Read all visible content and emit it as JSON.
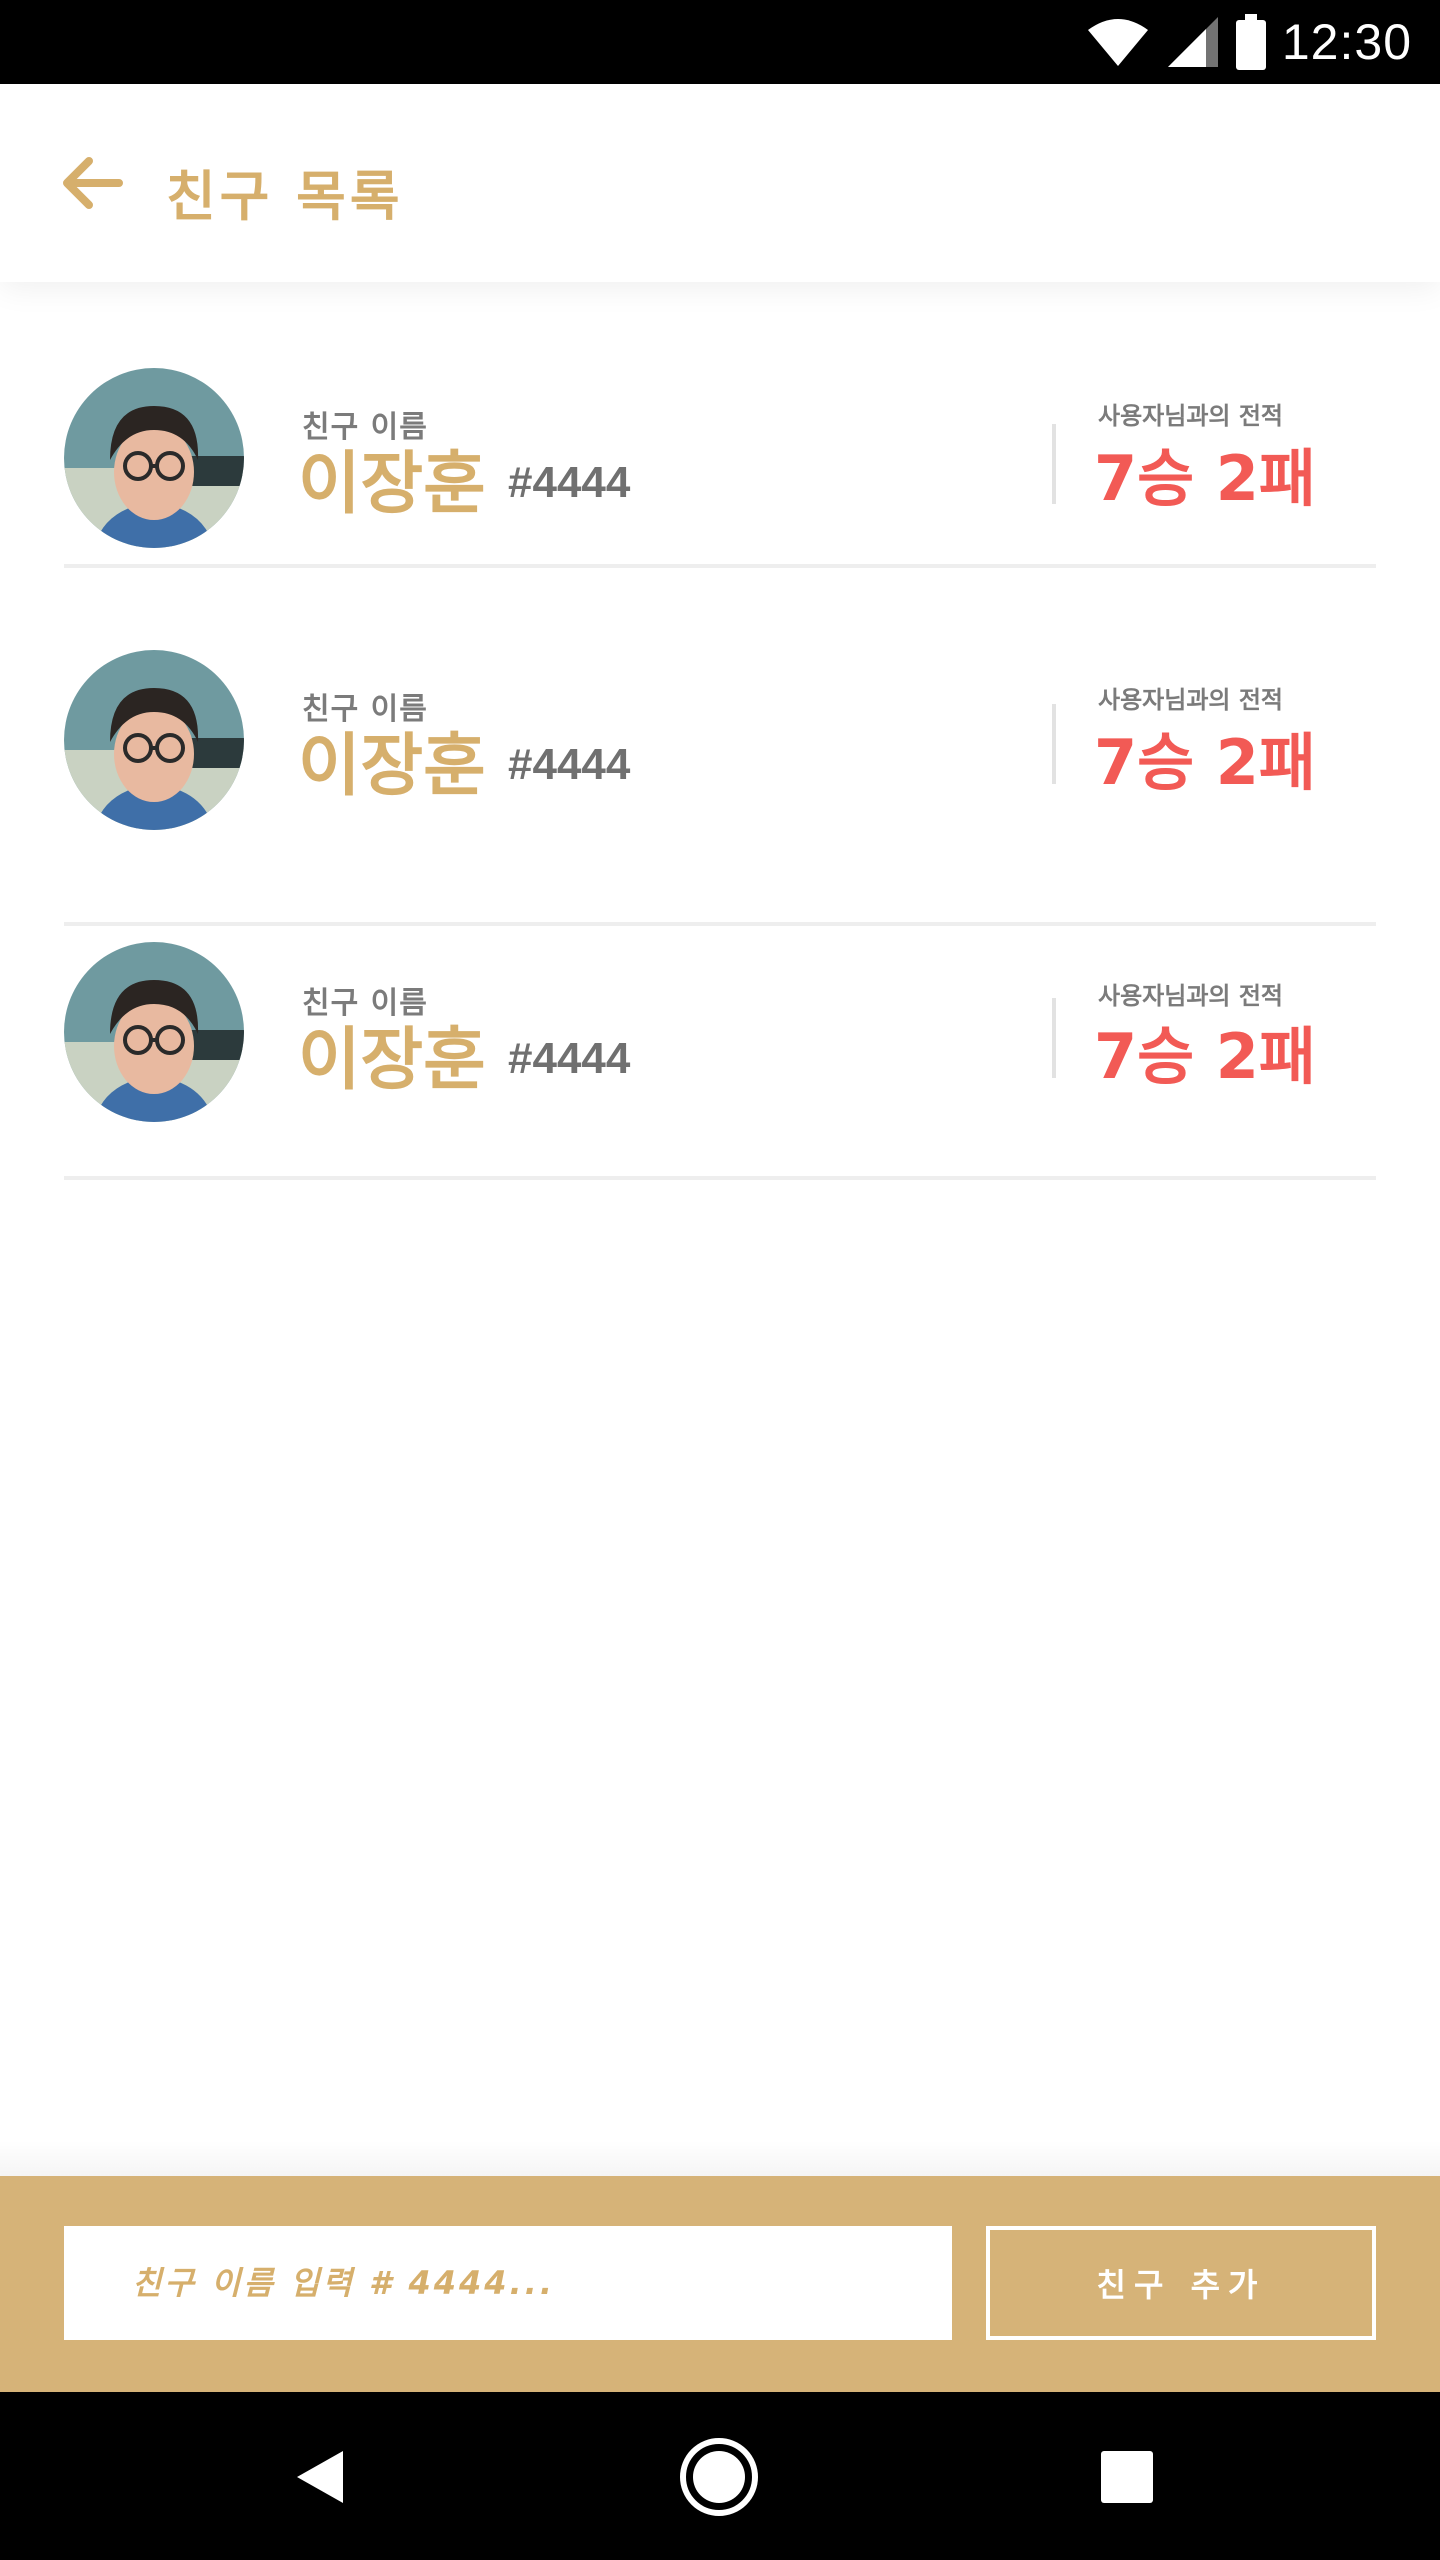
{
  "status_bar": {
    "time": "12:30",
    "icons": [
      "wifi-icon",
      "cellular-signal-icon",
      "battery-icon"
    ]
  },
  "app_bar": {
    "title": "친구 목록",
    "back_icon": "arrow-back-icon"
  },
  "friends": [
    {
      "caption": "친구 이름",
      "name": "이장훈",
      "tag": "#4444",
      "record_caption": "사용자님과의 전적",
      "record": "7승 2패"
    },
    {
      "caption": "친구 이름",
      "name": "이장훈",
      "tag": "#4444",
      "record_caption": "사용자님과의 전적",
      "record": "7승 2패"
    },
    {
      "caption": "친구 이름",
      "name": "이장훈",
      "tag": "#4444",
      "record_caption": "사용자님과의 전적",
      "record": "7승 2패"
    }
  ],
  "add_friend": {
    "input_placeholder": "친구 이름 입력 # 4444...",
    "input_value": "",
    "button_label": "친구 추가"
  },
  "nav_bar": {
    "icons": [
      "nav-back-icon",
      "nav-home-icon",
      "nav-recents-icon"
    ]
  },
  "colors": {
    "accent_gold": "#d6af6c",
    "bar_gold": "#d6b378",
    "record_red": "#f25a55",
    "gray_text": "#7b7b7b"
  }
}
